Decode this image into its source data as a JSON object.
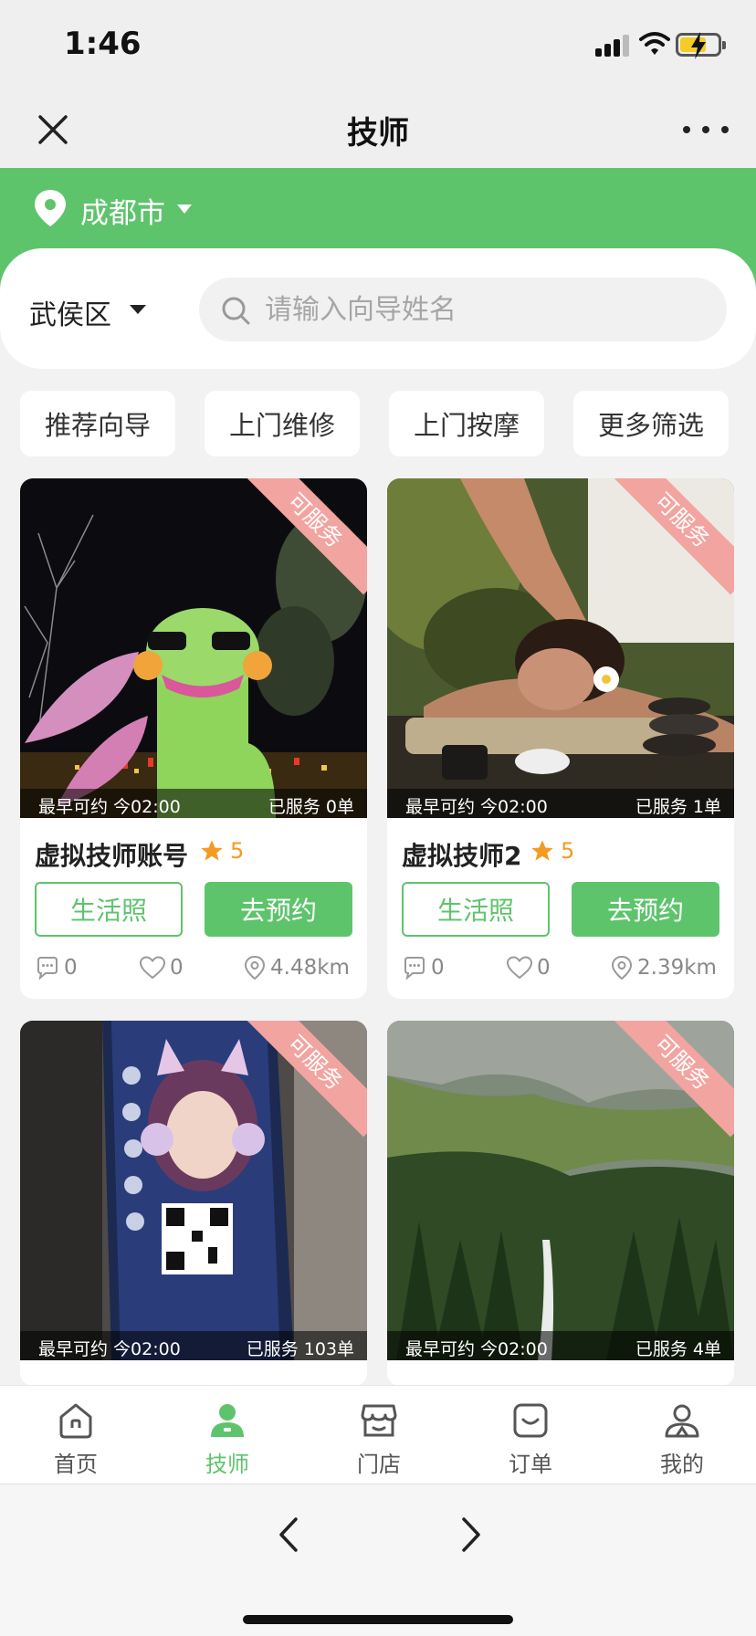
{
  "status_bar": {
    "time": "1:46"
  },
  "nav": {
    "title": "技师"
  },
  "location": {
    "city": "成都市"
  },
  "search": {
    "district": "武侯区",
    "placeholder": "请输入向导姓名"
  },
  "chips": [
    "推荐向导",
    "上门维修",
    "上门按摩",
    "更多筛选"
  ],
  "cards": [
    {
      "ribbon": "可服务",
      "earliest": "最早可约 今02:00",
      "served": "已服务 0单",
      "name": "虚拟技师账号",
      "rating": "5",
      "photo_label": "生活照",
      "book_label": "去预约",
      "comments": "0",
      "likes": "0",
      "distance": "4.48km"
    },
    {
      "ribbon": "可服务",
      "earliest": "最早可约 今02:00",
      "served": "已服务 1单",
      "name": "虚拟技师2",
      "rating": "5",
      "photo_label": "生活照",
      "book_label": "去预约",
      "comments": "0",
      "likes": "0",
      "distance": "2.39km"
    },
    {
      "ribbon": "可服务",
      "earliest": "最早可约 今02:00",
      "served": "已服务 103单",
      "name": ""
    },
    {
      "ribbon": "可服务",
      "earliest": "最早可约 今02:00",
      "served": "已服务 4单",
      "name": ""
    }
  ],
  "tabs": [
    {
      "label": "首页",
      "icon": "home-icon"
    },
    {
      "label": "技师",
      "icon": "technician-icon"
    },
    {
      "label": "门店",
      "icon": "store-icon"
    },
    {
      "label": "订单",
      "icon": "order-icon"
    },
    {
      "label": "我的",
      "icon": "profile-icon"
    }
  ],
  "active_tab": "技师",
  "colors": {
    "accent": "#5ec46c",
    "star": "#f39b22",
    "ribbon": "#f2a4a0"
  }
}
